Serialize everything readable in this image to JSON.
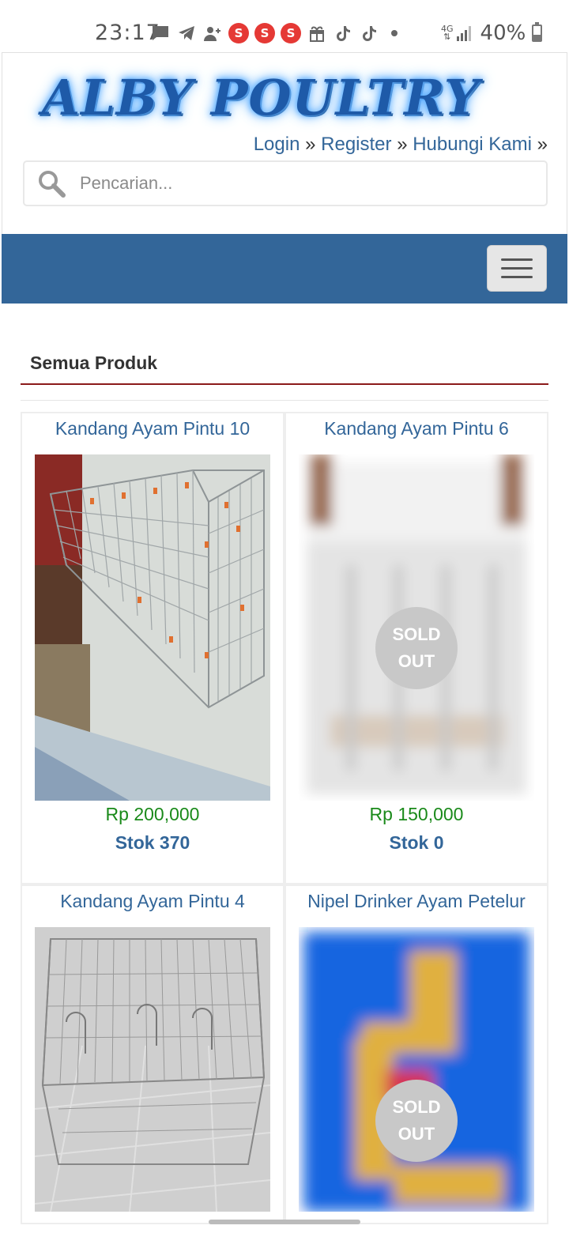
{
  "status_bar": {
    "time": "23:17",
    "network": "4G",
    "battery": "40%",
    "battery_level": 0.4,
    "notification_icons": [
      "message-icon",
      "telegram-icon",
      "add-contact-icon",
      "s-badge",
      "s-badge",
      "s-badge",
      "gift-icon",
      "tiktok-icon",
      "tiktok-icon",
      "dot-icon"
    ],
    "s_badge_label": "S"
  },
  "header": {
    "logo_text": "ALBY POULTRY",
    "links": [
      {
        "label": "Login"
      },
      {
        "label": "Register"
      },
      {
        "label": "Hubungi Kami"
      }
    ],
    "separator": "»",
    "search_placeholder": "Pencarian..."
  },
  "nav": {
    "menu_icon": "hamburger-icon",
    "bar_color": "#336699"
  },
  "main": {
    "section_title": "Semua Produk",
    "products": [
      {
        "name": "Kandang Ayam Pintu 10",
        "price": "Rp 200,000",
        "stock": "Stok 370",
        "sold_out": ""
      },
      {
        "name": "Kandang Ayam Pintu 6",
        "price": "Rp 150,000",
        "stock": "Stok 0",
        "sold_out": "SOLD OUT",
        "sold_out_line1": "SOLD",
        "sold_out_line2": "OUT"
      },
      {
        "name": "Kandang Ayam Pintu 4",
        "price": "",
        "stock": "",
        "sold_out": ""
      },
      {
        "name": "Nipel Drinker Ayam Petelur",
        "price": "",
        "stock": "",
        "sold_out": "SOLD OUT",
        "sold_out_line1": "SOLD",
        "sold_out_line2": "OUT"
      }
    ]
  },
  "colors": {
    "accent": "#336699",
    "price": "#1a8a1a",
    "divider": "#8b1a1a"
  }
}
